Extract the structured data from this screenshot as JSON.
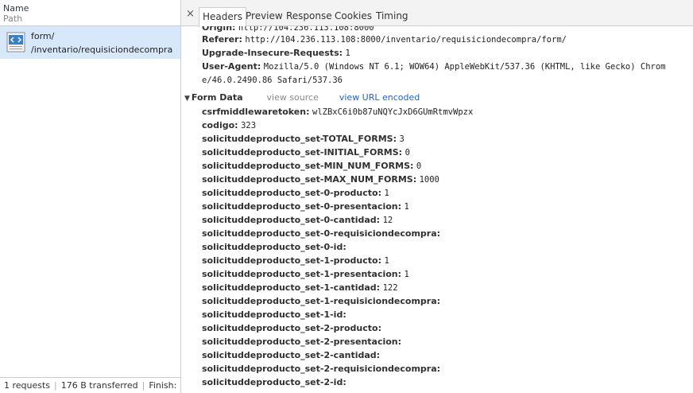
{
  "list": {
    "col_name": "Name",
    "col_path": "Path",
    "request": {
      "name": "form/",
      "path": "/inventario/requisiciondecompra"
    },
    "status": {
      "requests": "1 requests",
      "transferred": "176 B transferred",
      "finish": "Finish: ..."
    }
  },
  "tabs": {
    "close": "×",
    "items": [
      {
        "label": "Headers",
        "active": true
      },
      {
        "label": "Preview"
      },
      {
        "label": "Response"
      },
      {
        "label": "Cookies"
      },
      {
        "label": "Timing"
      }
    ]
  },
  "headers": {
    "origin": {
      "key": "Origin:",
      "value": "http://104.236.113.108:8000"
    },
    "referer": {
      "key": "Referer:",
      "value": "http://104.236.113.108:8000/inventario/requisiciondecompra/form/"
    },
    "upgrade": {
      "key": "Upgrade-Insecure-Requests:",
      "value": "1"
    },
    "ua": {
      "key": "User-Agent:",
      "value_line1": "Mozilla/5.0 (Windows NT 6.1; WOW64) AppleWebKit/537.36 (KHTML, like Gecko) Chrom",
      "value_line2": "e/46.0.2490.86 Safari/537.36"
    }
  },
  "form_data": {
    "title": "Form Data",
    "view_source": "view source",
    "view_url_encoded": "view URL encoded",
    "items": [
      {
        "key": "csrfmiddlewaretoken:",
        "value": "wlZBxC6i0b87uNQYcJxD6GUmRtmvWpzx"
      },
      {
        "key": "codigo:",
        "value": "323"
      },
      {
        "key": "solicituddeproducto_set-TOTAL_FORMS:",
        "value": "3"
      },
      {
        "key": "solicituddeproducto_set-INITIAL_FORMS:",
        "value": "0"
      },
      {
        "key": "solicituddeproducto_set-MIN_NUM_FORMS:",
        "value": "0"
      },
      {
        "key": "solicituddeproducto_set-MAX_NUM_FORMS:",
        "value": "1000"
      },
      {
        "key": "solicituddeproducto_set-0-producto:",
        "value": "1"
      },
      {
        "key": "solicituddeproducto_set-0-presentacion:",
        "value": "1"
      },
      {
        "key": "solicituddeproducto_set-0-cantidad:",
        "value": "12"
      },
      {
        "key": "solicituddeproducto_set-0-requisiciondecompra:",
        "value": ""
      },
      {
        "key": "solicituddeproducto_set-0-id:",
        "value": ""
      },
      {
        "key": "solicituddeproducto_set-1-producto:",
        "value": "1"
      },
      {
        "key": "solicituddeproducto_set-1-presentacion:",
        "value": "1"
      },
      {
        "key": "solicituddeproducto_set-1-cantidad:",
        "value": "122"
      },
      {
        "key": "solicituddeproducto_set-1-requisiciondecompra:",
        "value": ""
      },
      {
        "key": "solicituddeproducto_set-1-id:",
        "value": ""
      },
      {
        "key": "solicituddeproducto_set-2-producto:",
        "value": ""
      },
      {
        "key": "solicituddeproducto_set-2-presentacion:",
        "value": ""
      },
      {
        "key": "solicituddeproducto_set-2-cantidad:",
        "value": ""
      },
      {
        "key": "solicituddeproducto_set-2-requisiciondecompra:",
        "value": ""
      },
      {
        "key": "solicituddeproducto_set-2-id:",
        "value": ""
      }
    ]
  },
  "colors": {
    "selected_row": "#d8e8fb",
    "link": "#2a62b8",
    "border": "#cdcdcd"
  }
}
